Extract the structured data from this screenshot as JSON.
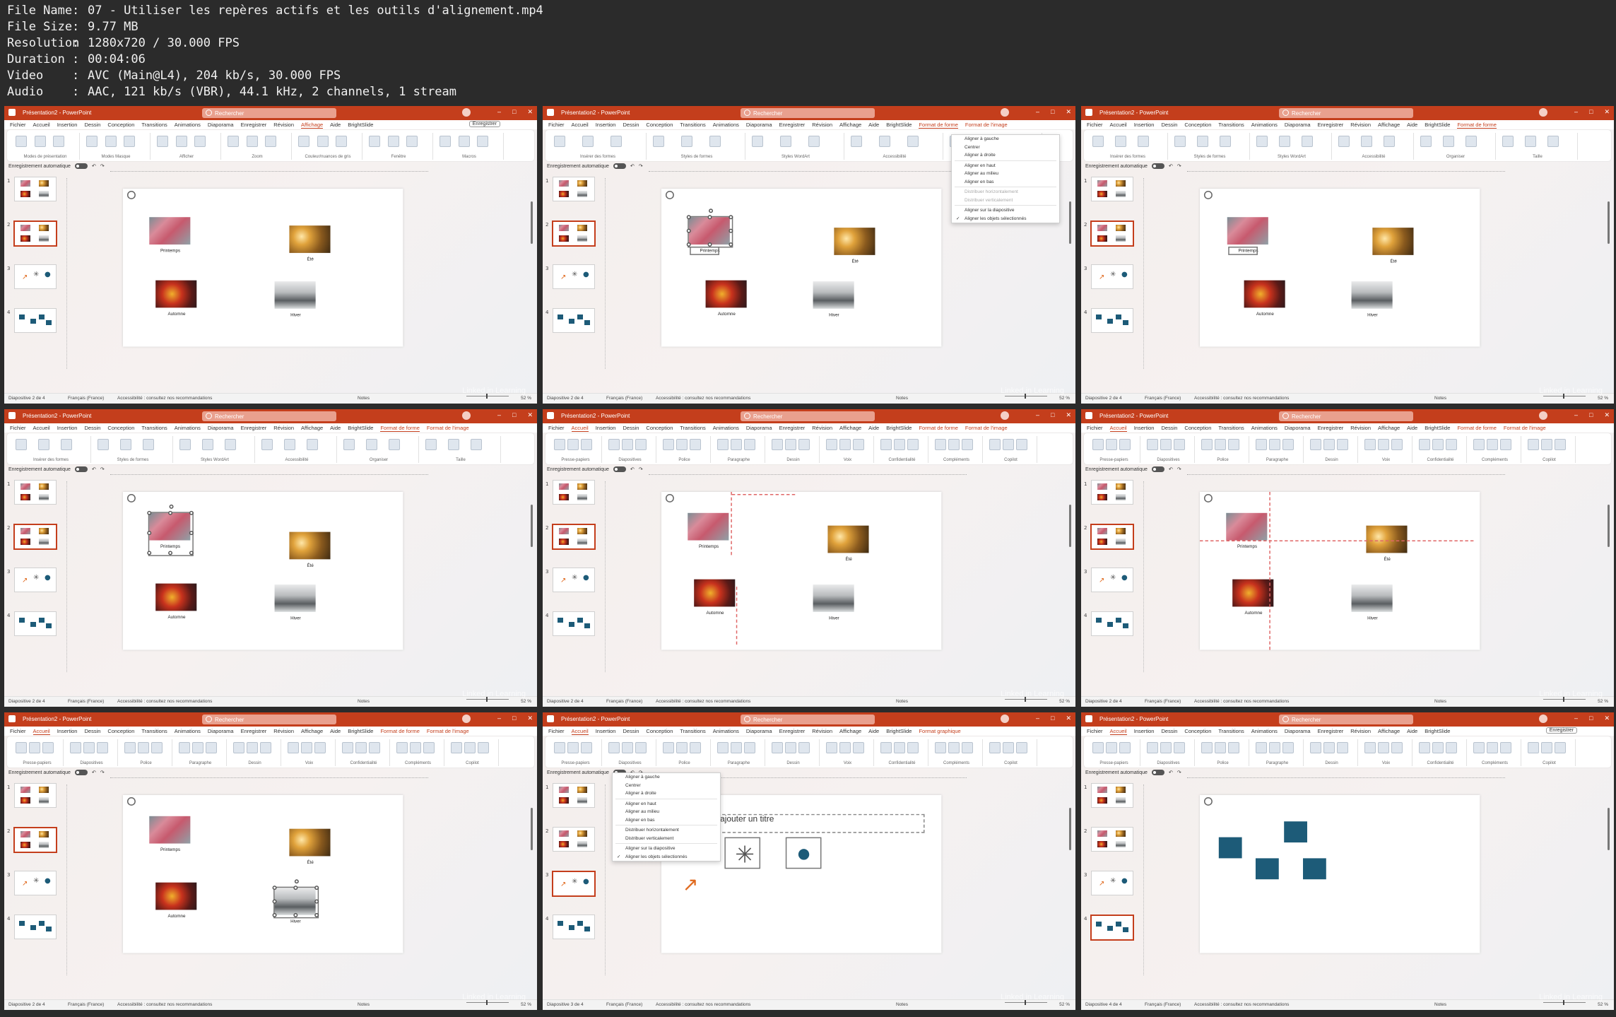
{
  "file_info": [
    {
      "key": "File Name",
      "value": "07 - Utiliser les repères actifs et les outils d'alignement.mp4"
    },
    {
      "key": "File Size",
      "value": "9.77 MB"
    },
    {
      "key": "Resolution",
      "value": "1280x720 / 30.000 FPS"
    },
    {
      "key": "Duration",
      "value": "00:04:06"
    },
    {
      "key": "Video",
      "value": "AVC (Main@L4), 204 kb/s, 30.000 FPS"
    },
    {
      "key": "Audio",
      "value": "AAC, 121 kb/s (VBR), 44.1 kHz, 2 channels, 1 stream"
    }
  ],
  "app": {
    "title": "Présentation2 - PowerPoint",
    "search": "Rechercher",
    "autosave": "Enregistrement automatique",
    "save_button": "Enregistrer",
    "watermark": "Linked in Learning"
  },
  "frames": [
    {
      "menu": [
        "Fichier",
        "Accueil",
        "Insertion",
        "Dessin",
        "Conception",
        "Transitions",
        "Animations",
        "Diaporama",
        "Enregistrer",
        "Révision",
        "Affichage",
        "Aide",
        "BrightSlide"
      ],
      "active_tab": "Affichage",
      "ribbon_groups": [
        "Modes de présentation",
        "Modes Masque",
        "Afficher",
        "Zoom",
        "Couleur/nuances de gris",
        "Fenêtre",
        "Macros"
      ],
      "status": "Diapositive 2 de 4"
    },
    {
      "menu": [
        "Fichier",
        "Accueil",
        "Insertion",
        "Dessin",
        "Conception",
        "Transitions",
        "Animations",
        "Diaporama",
        "Enregistrer",
        "Révision",
        "Affichage",
        "Aide",
        "BrightSlide",
        "Format de forme",
        "Format de l'image"
      ],
      "active_tab": "Format de forme",
      "ribbon_groups": [
        "Insérer des formes",
        "Styles de formes",
        "Styles WordArt",
        "Accessibilité",
        "Organiser"
      ],
      "status": "Diapositive 2 de 4"
    },
    {
      "menu": [
        "Fichier",
        "Accueil",
        "Insertion",
        "Dessin",
        "Conception",
        "Transitions",
        "Animations",
        "Diaporama",
        "Enregistrer",
        "Révision",
        "Affichage",
        "Aide",
        "BrightSlide",
        "Format de forme"
      ],
      "active_tab": "Format de forme",
      "ribbon_groups": [
        "Insérer des formes",
        "Styles de formes",
        "Styles WordArt",
        "Accessibilité",
        "Organiser",
        "Taille"
      ],
      "status": "Diapositive 2 de 4"
    },
    {
      "menu": [
        "Fichier",
        "Accueil",
        "Insertion",
        "Dessin",
        "Conception",
        "Transitions",
        "Animations",
        "Diaporama",
        "Enregistrer",
        "Révision",
        "Affichage",
        "Aide",
        "BrightSlide",
        "Format de forme",
        "Format de l'image"
      ],
      "active_tab": "Format de forme",
      "ribbon_groups": [
        "Insérer des formes",
        "Styles de formes",
        "Styles WordArt",
        "Accessibilité",
        "Organiser",
        "Taille"
      ],
      "status": "Diapositive 2 de 4"
    },
    {
      "menu": [
        "Fichier",
        "Accueil",
        "Insertion",
        "Dessin",
        "Conception",
        "Transitions",
        "Animations",
        "Diaporama",
        "Enregistrer",
        "Révision",
        "Affichage",
        "Aide",
        "BrightSlide",
        "Format de forme",
        "Format de l'image"
      ],
      "active_tab": "Accueil",
      "ribbon_groups": [
        "Presse-papiers",
        "Diapositives",
        "Police",
        "Paragraphe",
        "Dessin",
        "Voix",
        "Confidentialité",
        "Compléments",
        "Copilot"
      ],
      "status": "Diapositive 2 de 4"
    },
    {
      "menu": [
        "Fichier",
        "Accueil",
        "Insertion",
        "Dessin",
        "Conception",
        "Transitions",
        "Animations",
        "Diaporama",
        "Enregistrer",
        "Révision",
        "Affichage",
        "Aide",
        "BrightSlide",
        "Format de forme",
        "Format de l'image"
      ],
      "active_tab": "Accueil",
      "ribbon_groups": [
        "Presse-papiers",
        "Diapositives",
        "Police",
        "Paragraphe",
        "Dessin",
        "Voix",
        "Confidentialité",
        "Compléments",
        "Copilot"
      ],
      "status": "Diapositive 2 de 4"
    },
    {
      "menu": [
        "Fichier",
        "Accueil",
        "Insertion",
        "Dessin",
        "Conception",
        "Transitions",
        "Animations",
        "Diaporama",
        "Enregistrer",
        "Révision",
        "Affichage",
        "Aide",
        "BrightSlide",
        "Format de forme",
        "Format de l'image"
      ],
      "active_tab": "Accueil",
      "ribbon_groups": [
        "Presse-papiers",
        "Diapositives",
        "Police",
        "Paragraphe",
        "Dessin",
        "Voix",
        "Confidentialité",
        "Compléments",
        "Copilot"
      ],
      "status": "Diapositive 2 de 4"
    },
    {
      "menu": [
        "Fichier",
        "Accueil",
        "Insertion",
        "Dessin",
        "Conception",
        "Transitions",
        "Animations",
        "Diaporama",
        "Enregistrer",
        "Révision",
        "Affichage",
        "Aide",
        "BrightSlide",
        "Format graphique"
      ],
      "active_tab": "Accueil",
      "ribbon_groups": [
        "Presse-papiers",
        "Diapositives",
        "Police",
        "Paragraphe",
        "Dessin",
        "Voix",
        "Confidentialité",
        "Compléments",
        "Copilot"
      ],
      "status": "Diapositive 3 de 4"
    },
    {
      "menu": [
        "Fichier",
        "Accueil",
        "Insertion",
        "Dessin",
        "Conception",
        "Transitions",
        "Animations",
        "Diaporama",
        "Enregistrer",
        "Révision",
        "Affichage",
        "Aide",
        "BrightSlide"
      ],
      "active_tab": "Accueil",
      "ribbon_groups": [
        "Presse-papiers",
        "Diapositives",
        "Police",
        "Paragraphe",
        "Dessin",
        "Voix",
        "Confidentialité",
        "Compléments",
        "Copilot"
      ],
      "status": "Diapositive 4 de 4"
    }
  ],
  "status_common": {
    "language": "Français (France)",
    "accessibility": "Accessibilité : consultez nos recommandations",
    "notes": "Notes",
    "zoom": "52 %"
  },
  "captions": {
    "spring": "Printemps",
    "summer": "Été",
    "autumn": "Automne",
    "winter": "Hiver"
  },
  "slide3_title": "our ajouter un titre",
  "align_menu": [
    {
      "label": "Aligner à gauche",
      "disabled": false,
      "checked": false
    },
    {
      "label": "Centrer",
      "disabled": false,
      "checked": false
    },
    {
      "label": "Aligner à droite",
      "disabled": false,
      "checked": false
    },
    {
      "sep": true
    },
    {
      "label": "Aligner en haut",
      "disabled": false,
      "checked": false
    },
    {
      "label": "Aligner au milieu",
      "disabled": false,
      "checked": false
    },
    {
      "label": "Aligner en bas",
      "disabled": false,
      "checked": false
    },
    {
      "sep": true
    },
    {
      "label": "Distribuer horizontalement",
      "disabled": true,
      "checked": false
    },
    {
      "label": "Distribuer verticalement",
      "disabled": true,
      "checked": false
    },
    {
      "sep": true
    },
    {
      "label": "Aligner sur la diapositive",
      "disabled": false,
      "checked": false
    },
    {
      "label": "Aligner les objets sélectionnés",
      "disabled": false,
      "checked": true
    }
  ],
  "align_menu_enabled": [
    {
      "label": "Aligner à gauche",
      "disabled": false,
      "checked": false
    },
    {
      "label": "Centrer",
      "disabled": false,
      "checked": false
    },
    {
      "label": "Aligner à droite",
      "disabled": false,
      "checked": false
    },
    {
      "sep": true
    },
    {
      "label": "Aligner en haut",
      "disabled": false,
      "checked": false
    },
    {
      "label": "Aligner au milieu",
      "disabled": false,
      "checked": false
    },
    {
      "label": "Aligner en bas",
      "disabled": false,
      "checked": false
    },
    {
      "sep": true
    },
    {
      "label": "Distribuer horizontalement",
      "disabled": false,
      "checked": false
    },
    {
      "label": "Distribuer verticalement",
      "disabled": false,
      "checked": false
    },
    {
      "sep": true
    },
    {
      "label": "Aligner sur la diapositive",
      "disabled": false,
      "checked": false
    },
    {
      "label": "Aligner les objets sélectionnés",
      "disabled": false,
      "checked": true
    }
  ],
  "colors": {
    "accent": "#c43e1c",
    "shape": "#1d5b78"
  }
}
